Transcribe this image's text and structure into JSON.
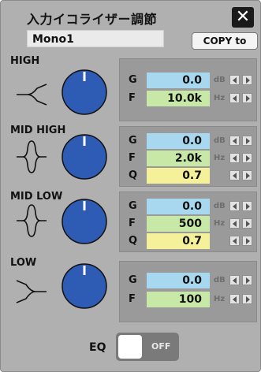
{
  "window": {
    "title": "入力イコライザー調節"
  },
  "channel": {
    "name": "Mono1"
  },
  "toolbar": {
    "copy_label": "COPY to"
  },
  "bands": [
    {
      "label": "HIGH",
      "curve": "high-shelf-icon",
      "params": [
        {
          "label": "G",
          "value": "0.0",
          "unit": "dB",
          "kind": "gain"
        },
        {
          "label": "F",
          "value": "10.0k",
          "unit": "Hz",
          "kind": "freq"
        }
      ]
    },
    {
      "label": "MID HIGH",
      "curve": "peak-icon",
      "params": [
        {
          "label": "G",
          "value": "0.0",
          "unit": "dB",
          "kind": "gain"
        },
        {
          "label": "F",
          "value": "2.0k",
          "unit": "Hz",
          "kind": "freq"
        },
        {
          "label": "Q",
          "value": "0.7",
          "unit": "",
          "kind": "q"
        }
      ]
    },
    {
      "label": "MID LOW",
      "curve": "peak-icon",
      "params": [
        {
          "label": "G",
          "value": "0.0",
          "unit": "dB",
          "kind": "gain"
        },
        {
          "label": "F",
          "value": "500",
          "unit": "Hz",
          "kind": "freq"
        },
        {
          "label": "Q",
          "value": "0.7",
          "unit": "",
          "kind": "q"
        }
      ]
    },
    {
      "label": "LOW",
      "curve": "low-shelf-icon",
      "params": [
        {
          "label": "G",
          "value": "0.0",
          "unit": "dB",
          "kind": "gain"
        },
        {
          "label": "F",
          "value": "100",
          "unit": "Hz",
          "kind": "freq"
        }
      ]
    }
  ],
  "eq": {
    "label": "EQ",
    "state": "OFF"
  },
  "colors": {
    "knob": "#2e5bb3",
    "gain": "#a8d8ef",
    "freq": "#c8e8a8",
    "q": "#f5f09a"
  }
}
